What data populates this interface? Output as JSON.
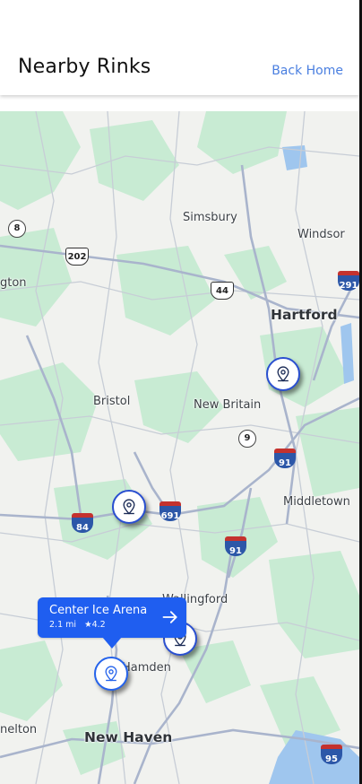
{
  "header": {
    "title": "Nearby Rinks",
    "back_label": "Back Home"
  },
  "map": {
    "place_labels": [
      {
        "text": "Simsbury",
        "type": "town"
      },
      {
        "text": "Windsor",
        "type": "town"
      },
      {
        "text": "gton",
        "type": "town"
      },
      {
        "text": "Hartford",
        "type": "city"
      },
      {
        "text": "Bristol",
        "type": "town"
      },
      {
        "text": "New Britain",
        "type": "town"
      },
      {
        "text": "Middletown",
        "type": "town"
      },
      {
        "text": "Wallingford",
        "type": "town"
      },
      {
        "text": "Hamden",
        "type": "town"
      },
      {
        "text": "nelton",
        "type": "town"
      },
      {
        "text": "New Haven",
        "type": "city"
      }
    ],
    "route_shields": [
      {
        "number": "8",
        "kind": "state"
      },
      {
        "number": "202",
        "kind": "us"
      },
      {
        "number": "44",
        "kind": "us"
      },
      {
        "number": "291",
        "kind": "interstate"
      },
      {
        "number": "9",
        "kind": "state"
      },
      {
        "number": "91",
        "kind": "interstate"
      },
      {
        "number": "84",
        "kind": "interstate"
      },
      {
        "number": "691",
        "kind": "interstate"
      },
      {
        "number": "91",
        "kind": "interstate"
      },
      {
        "number": "95",
        "kind": "interstate"
      }
    ],
    "markers": [
      {
        "icon": "location-pin-icon",
        "active": false
      },
      {
        "icon": "location-pin-icon",
        "active": false
      },
      {
        "icon": "location-pin-icon",
        "active": false
      },
      {
        "icon": "location-pin-icon",
        "active": true
      }
    ]
  },
  "callout": {
    "name": "Center Ice Arena",
    "distance": "2.1 mi",
    "rating": "4.2",
    "rating_icon": "star-icon",
    "arrow_icon": "arrow-right-icon"
  },
  "colors": {
    "accent": "#1f5ef0",
    "link": "#4a7fe0",
    "park_green": "#c8ebd3",
    "road": "#a9b4cc",
    "water": "#9fc6ee"
  }
}
